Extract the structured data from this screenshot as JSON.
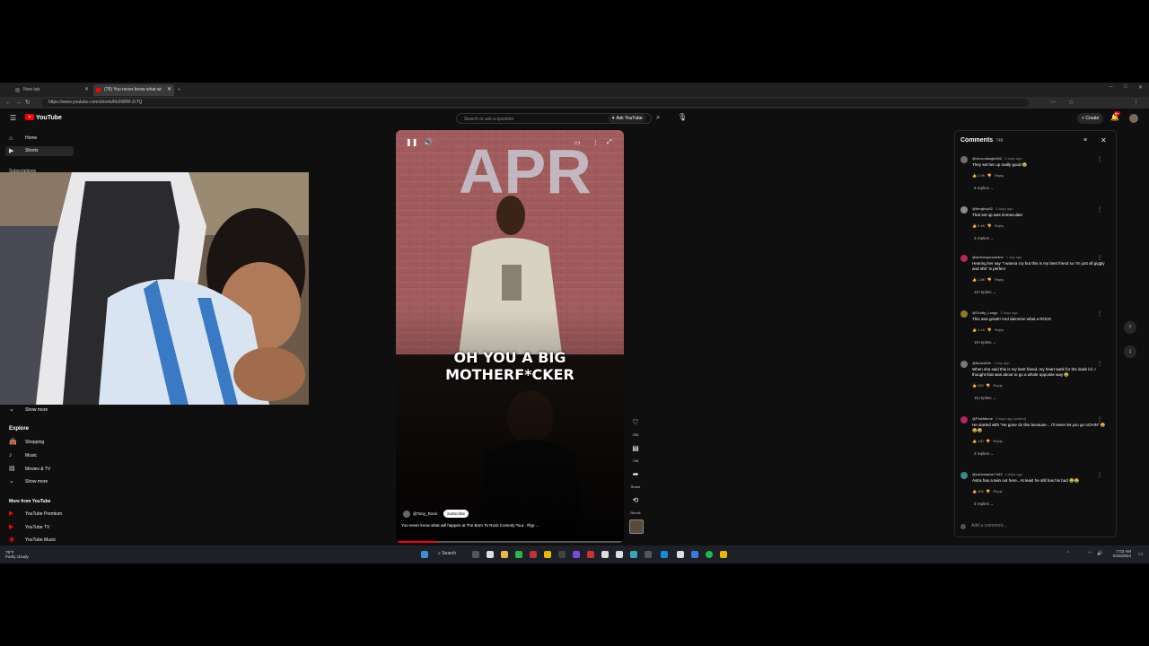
{
  "browser": {
    "tabs": [
      {
        "label": "New tab",
        "active": false
      },
      {
        "label": "(78) You never know what wi",
        "active": true
      }
    ],
    "new_tab": "+",
    "url": "https://www.youtube.com/shorts/Kk9WfW-Zr7Q",
    "window_controls": [
      "–",
      "□",
      "✕"
    ]
  },
  "youtube": {
    "logo": "YouTube",
    "search_placeholder": "Search or ask a question",
    "ask_label": "Ask YouTube",
    "create_label": "Create",
    "notification_count": "9+"
  },
  "sidebar": {
    "items": [
      {
        "label": "Home",
        "icon": "home-icon"
      },
      {
        "label": "Shorts",
        "icon": "shorts-icon"
      }
    ],
    "subscriptions_label": "Subscriptions",
    "show_more": "Show more",
    "explore_title": "Explore",
    "explore_items": [
      {
        "label": "Shopping",
        "icon": "bag-icon"
      },
      {
        "label": "Music",
        "icon": "music-icon"
      },
      {
        "label": "Movies & TV",
        "icon": "film-icon"
      }
    ],
    "explore_show_more": "Show more",
    "more_title": "More from YouTube",
    "more_items": [
      {
        "label": "YouTube Premium"
      },
      {
        "label": "YouTube TV"
      },
      {
        "label": "YouTube Music"
      }
    ]
  },
  "short": {
    "caption_line1": "OH YOU A BIG",
    "caption_line2": "MOTHERF*CKER",
    "channel": "@Tony_Rock",
    "subscribe_label": "Subscribe",
    "title": "You never know what will happen at The Born To Rock Comedy Tour.. #fyp ...",
    "progress": 0.18,
    "actions": [
      {
        "icon": "like-icon",
        "label": "25K"
      },
      {
        "icon": "comment-icon",
        "label": "746"
      },
      {
        "icon": "share-icon",
        "label": "Share"
      },
      {
        "icon": "remix-icon",
        "label": "Remix"
      }
    ]
  },
  "comments": {
    "title": "Comments",
    "count": "746",
    "add_placeholder": "Add a comment...",
    "items": [
      {
        "user": "@chocolatsgirl482",
        "time": "2 days ago",
        "text": "They set her up really good 😂",
        "likes": "2.5K",
        "replies": "9 replies",
        "color": "#6d6d6d"
      },
      {
        "user": "@bergboy92",
        "time": "2 days ago",
        "text": "That set up was immaculate",
        "likes": "5.4K",
        "replies": "3 replies",
        "color": "#8a8a8a"
      },
      {
        "user": "@anthonyamomine",
        "time": "1 day ago",
        "text": "Hearing her say \"I wanna cry but this is my best friend so I'm just all giggly and shit\" is perfect",
        "likes": "1.8K",
        "replies": "10 replies",
        "color": "#b3275a"
      },
      {
        "user": "@Scotty_Longz",
        "time": "2 days ago",
        "text": "This was great!! And dammnn what a ROCK",
        "likes": "1.1K",
        "replies": "18 replies",
        "color": "#8a7a2a"
      },
      {
        "user": "@itsJustMe",
        "time": "1 day ago",
        "text": "When she said this is my best friend..my heart sank for the dude lol. I thought that was about to go a whole opposite way 😂",
        "likes": "300",
        "replies": "15 replies",
        "color": "#777777"
      },
      {
        "user": "@PinkMeme",
        "time": "2 days ago (edited)",
        "text": "He started with \"He gone do this because....I'll never let you go AGAIN\" 😂😂😂",
        "likes": "130",
        "replies": "2 replies",
        "color": "#b3275a"
      },
      {
        "user": "@carlosaever7442",
        "time": "2 days ago",
        "text": "Astra has a twin out here...At least he still has his bad 😂😂",
        "likes": "306",
        "replies": "5 replies",
        "color": "#3a8a8a"
      }
    ],
    "reply_label": "Reply"
  },
  "taskbar": {
    "weather_temp": "79°F",
    "weather_desc": "Partly cloudy",
    "search_label": "Search",
    "time": "7:02 AM",
    "date": "6/15/2024"
  }
}
